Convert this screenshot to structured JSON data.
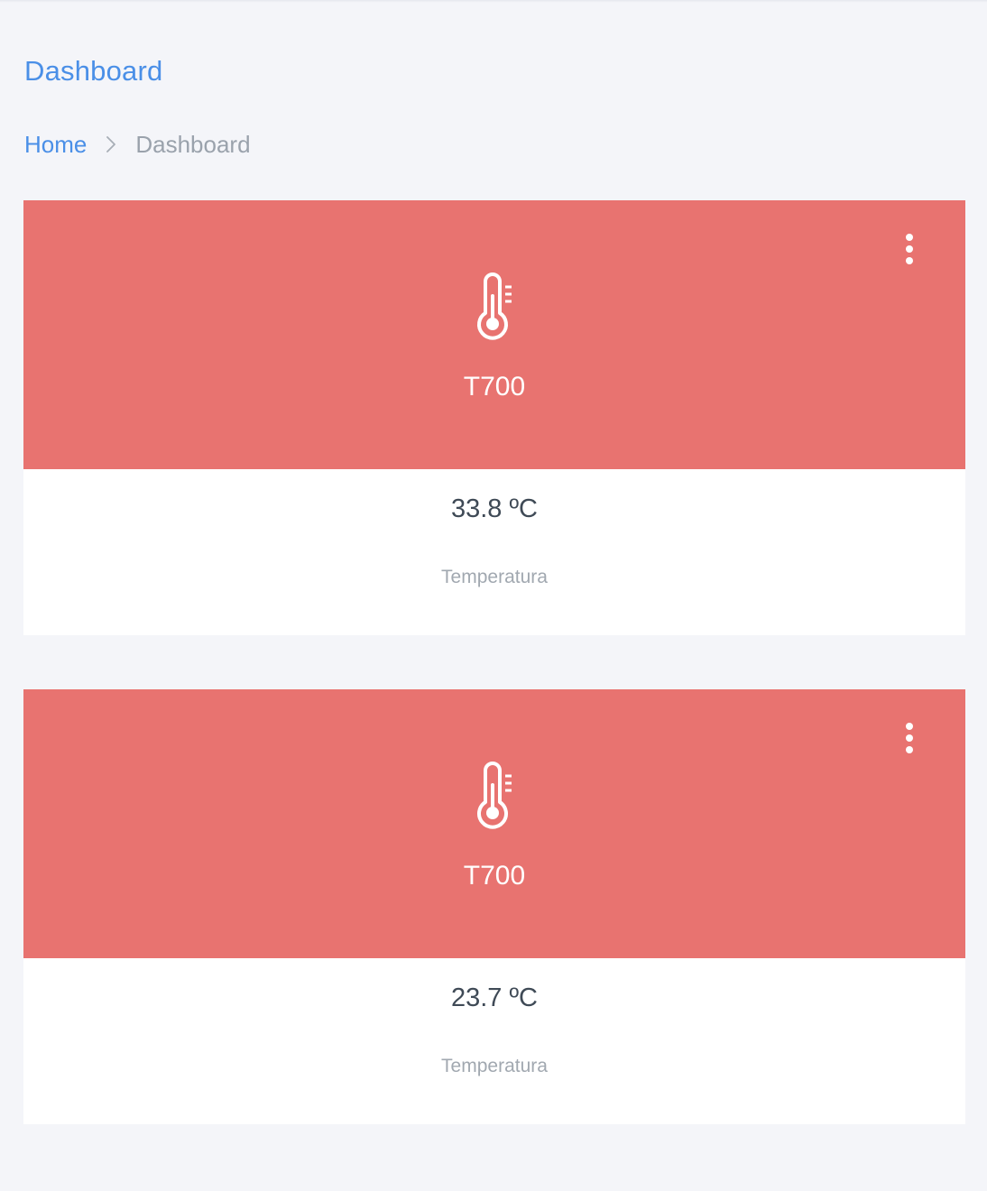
{
  "header": {
    "title": "Dashboard"
  },
  "breadcrumb": {
    "home_label": "Home",
    "separator_icon": "chevron-right-icon",
    "current_label": "Dashboard"
  },
  "colors": {
    "accent": "#4a8fe7",
    "card_header": "#e87370",
    "background": "#f4f5f9"
  },
  "cards": [
    {
      "icon": "thermometer-icon",
      "menu_icon": "more-vertical-icon",
      "device": "T700",
      "reading": "33.8 ºC",
      "metric_label": "Temperatura"
    },
    {
      "icon": "thermometer-icon",
      "menu_icon": "more-vertical-icon",
      "device": "T700",
      "reading": "23.7 ºC",
      "metric_label": "Temperatura"
    }
  ]
}
